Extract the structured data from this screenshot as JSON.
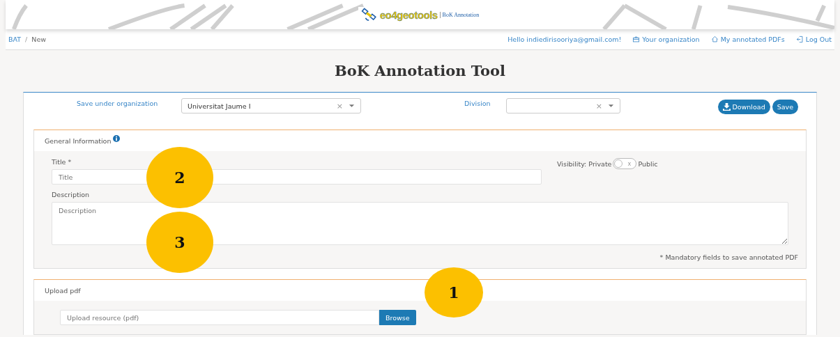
{
  "header": {
    "logo_text": "eo4geotools",
    "logo_subtitle": "BoK Annotation"
  },
  "breadcrumb_separator": "/",
  "breadcrumb": [
    {
      "label": "BAT",
      "link": true
    },
    {
      "label": "New",
      "link": false
    }
  ],
  "user_nav": [
    {
      "kind": "greeting",
      "label": "Hello indiedirisooriya@gmail.com!"
    },
    {
      "kind": "organization",
      "label": "Your organization"
    },
    {
      "kind": "home",
      "label": "My annotated PDFs"
    },
    {
      "kind": "logout",
      "label": "Log Out"
    }
  ],
  "page_title": "BoK Annotation Tool",
  "toolbar": {
    "organization": {
      "label": "Save under organization",
      "value": "Universitat Jaume I",
      "clear": "×"
    },
    "division": {
      "label": "Division",
      "clear": "×"
    },
    "buttons": [
      {
        "kind": "download",
        "label": "Download"
      },
      {
        "kind": "save",
        "label": "Save"
      }
    ]
  },
  "general_information": {
    "heading": "General Information",
    "title": {
      "label": "Title *",
      "placeholder": "Title",
      "callout": "2"
    },
    "visibility": {
      "label": "Visibility: Private",
      "toggle_mark": "x",
      "public_label": "Public",
      "on": false
    },
    "description": {
      "label": "Description",
      "placeholder": "Description",
      "callout": "3"
    },
    "note": "* Mandatory fields to save annotated PDF"
  },
  "upload": {
    "heading": "Upload pdf",
    "callout": "1",
    "placeholder": "Upload resource (pdf)",
    "button": "Browse"
  }
}
